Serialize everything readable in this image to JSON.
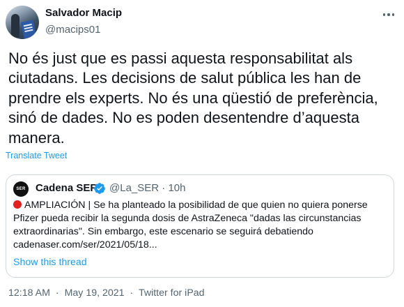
{
  "author": {
    "name": "Salvador Macip",
    "handle": "@macips01"
  },
  "tweet": {
    "text": "No és just que es passi aquesta responsabilitat als ciutadans. Les decisions de salut pública les han de prendre els experts. No és una qüestió de preferència, sinó de dades. No es poden desentendre d’aquesta manera.",
    "translate_label": "Translate Tweet"
  },
  "quote": {
    "avatar_text": "SER",
    "name": "Cadena SER",
    "handle": "@La_SER",
    "separator": "·",
    "time": "10h",
    "body": "AMPLIACIÓN | Se ha planteado la posibilidad de que quien no quiera ponerse Pfizer pueda recibir la segunda dosis de AstraZeneca \"dadas las circunstancias extraordinarias\". Sin embargo, este escenario se seguirá debatiendo cadenaser.com/ser/2021/05/18...",
    "show_thread": "Show this thread"
  },
  "meta": {
    "time": "12:18 AM",
    "separator": "·",
    "date": "May 19, 2021",
    "source": "Twitter for iPad"
  },
  "colors": {
    "link": "#1d9bf0",
    "secondary_text": "#536471",
    "border": "#cfd9de",
    "red_circle": "#e0211f"
  },
  "icons": [
    "more-icon",
    "verified-badge-icon",
    "red-circle-icon"
  ]
}
